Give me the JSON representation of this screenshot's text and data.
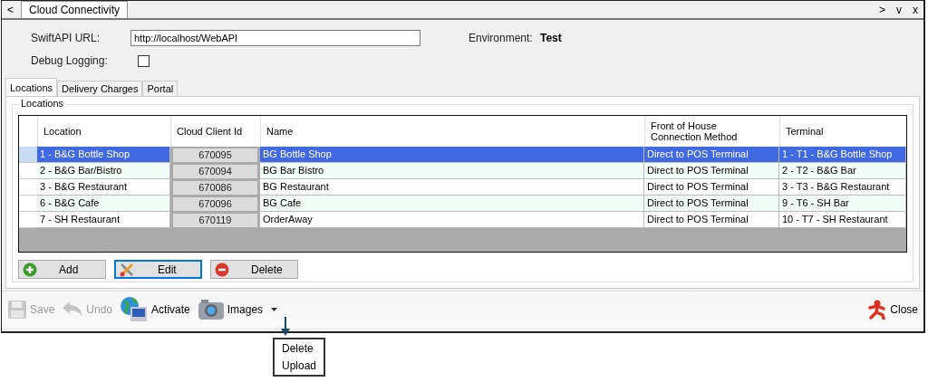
{
  "tab_strip": {
    "back": "<",
    "tabs": [
      {
        "label": "Cloud Connectivity",
        "selected": true
      }
    ],
    "controls": [
      ">",
      "v",
      "x"
    ]
  },
  "form": {
    "url_label": "SwiftAPI URL:",
    "url_value": "http://localhost/WebAPI",
    "env_label": "Environment:",
    "env_value": "Test",
    "debug_label": "Debug Logging:",
    "debug_checked": false
  },
  "tabs": [
    {
      "label": "Locations",
      "selected": true
    },
    {
      "label": "Delivery Charges",
      "selected": false
    },
    {
      "label": "Portal",
      "selected": false
    }
  ],
  "group_title": "Locations",
  "table": {
    "columns": [
      "Location",
      "Cloud Client Id",
      "Name",
      "Front of House\nConnection Method",
      "Terminal"
    ],
    "rows": [
      {
        "cells": [
          "1 - B&G Bottle Shop",
          "670095",
          "BG Bottle Shop",
          "Direct to POS Terminal",
          "1 - T1 - B&G Bottle Shop"
        ],
        "selected": true
      },
      {
        "cells": [
          "2 - B&G Bar/Bistro",
          "670094",
          "BG Bar Bistro",
          "Direct to POS Terminal",
          "2 - T2 - B&G Bar"
        ],
        "selected": false
      },
      {
        "cells": [
          "3 - B&G Restaurant",
          "670086",
          "BG Restaurant",
          "Direct to POS Terminal",
          "3 - T3 - B&G Restaurant"
        ],
        "selected": false
      },
      {
        "cells": [
          "6 - B&G Cafe",
          "670096",
          "BG Cafe",
          "Direct to POS Terminal",
          "9 - T6 - SH Bar"
        ],
        "selected": false
      },
      {
        "cells": [
          "7 - SH Restaurant",
          "670119",
          "OrderAway",
          "Direct to POS Terminal",
          "10 - T7 - SH Restaurant"
        ],
        "selected": false
      }
    ]
  },
  "grid_buttons": [
    {
      "kind": "add",
      "label": "Add",
      "focused": false
    },
    {
      "kind": "edit",
      "label": "Edit",
      "focused": true
    },
    {
      "kind": "delete",
      "label": "Delete",
      "focused": false
    }
  ],
  "toolbar": [
    {
      "kind": "save",
      "label": "Save",
      "disabled": true
    },
    {
      "kind": "undo",
      "label": "Undo",
      "disabled": true
    },
    {
      "kind": "activate",
      "label": "Activate",
      "disabled": false
    },
    {
      "kind": "images",
      "label": "Images",
      "disabled": false,
      "dropdown": true
    }
  ],
  "close_button": "Close",
  "dropdown_menu": [
    "Delete",
    "Upload"
  ]
}
